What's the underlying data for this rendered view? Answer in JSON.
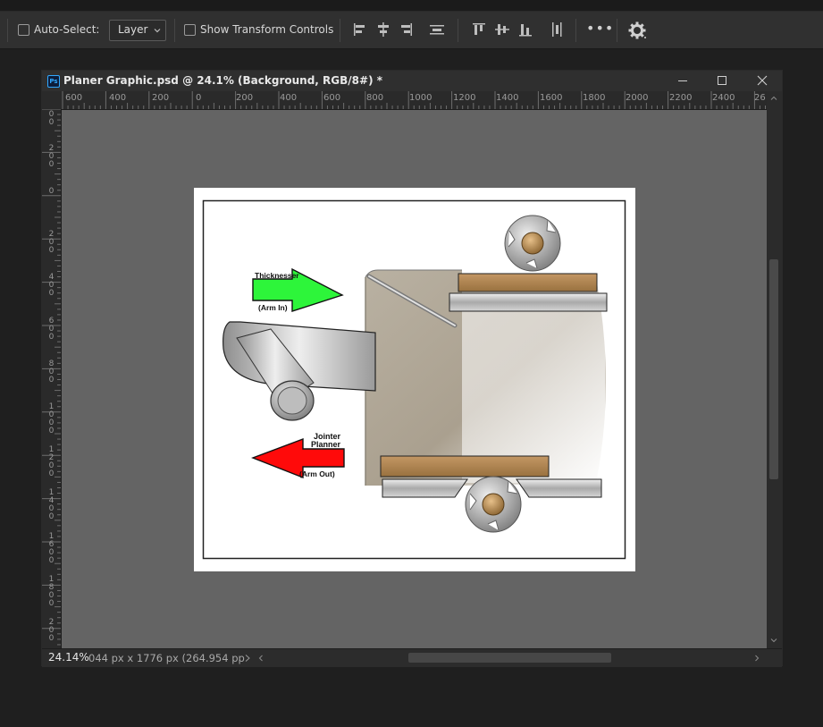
{
  "toolbar": {
    "auto_select_label": "Auto-Select:",
    "auto_select_value": "Layer",
    "show_transform_label": "Show Transform Controls",
    "more_label": "•••"
  },
  "window": {
    "title": "Planer Graphic.psd @ 24.1% (Background, RGB/8#) *",
    "ps_badge": "Ps"
  },
  "rulers": {
    "horizontal": [
      "600",
      "400",
      "200",
      "0",
      "200",
      "400",
      "600",
      "800",
      "1000",
      "1200",
      "1400",
      "1600",
      "1800",
      "2000",
      "2200",
      "2400",
      "26"
    ],
    "vertical": [
      "00",
      "200",
      "0",
      "200",
      "400",
      "600",
      "800",
      "1000",
      "1200",
      "1400",
      "1600",
      "1800",
      "200"
    ]
  },
  "status": {
    "zoom": "24.14%",
    "doc_info": "044 px x 1776 px (264.954 pp"
  },
  "graphic": {
    "thicknesser_label": "Thicknesser",
    "arm_in_label": "(Arm In)",
    "jointer_label": "Jointer",
    "planner_label": "Planner",
    "arm_out_label": "(Arm Out)",
    "colors": {
      "green_arrow": "#2df53a",
      "red_arrow": "#ff0a0a",
      "wood": "#a9814f"
    }
  }
}
